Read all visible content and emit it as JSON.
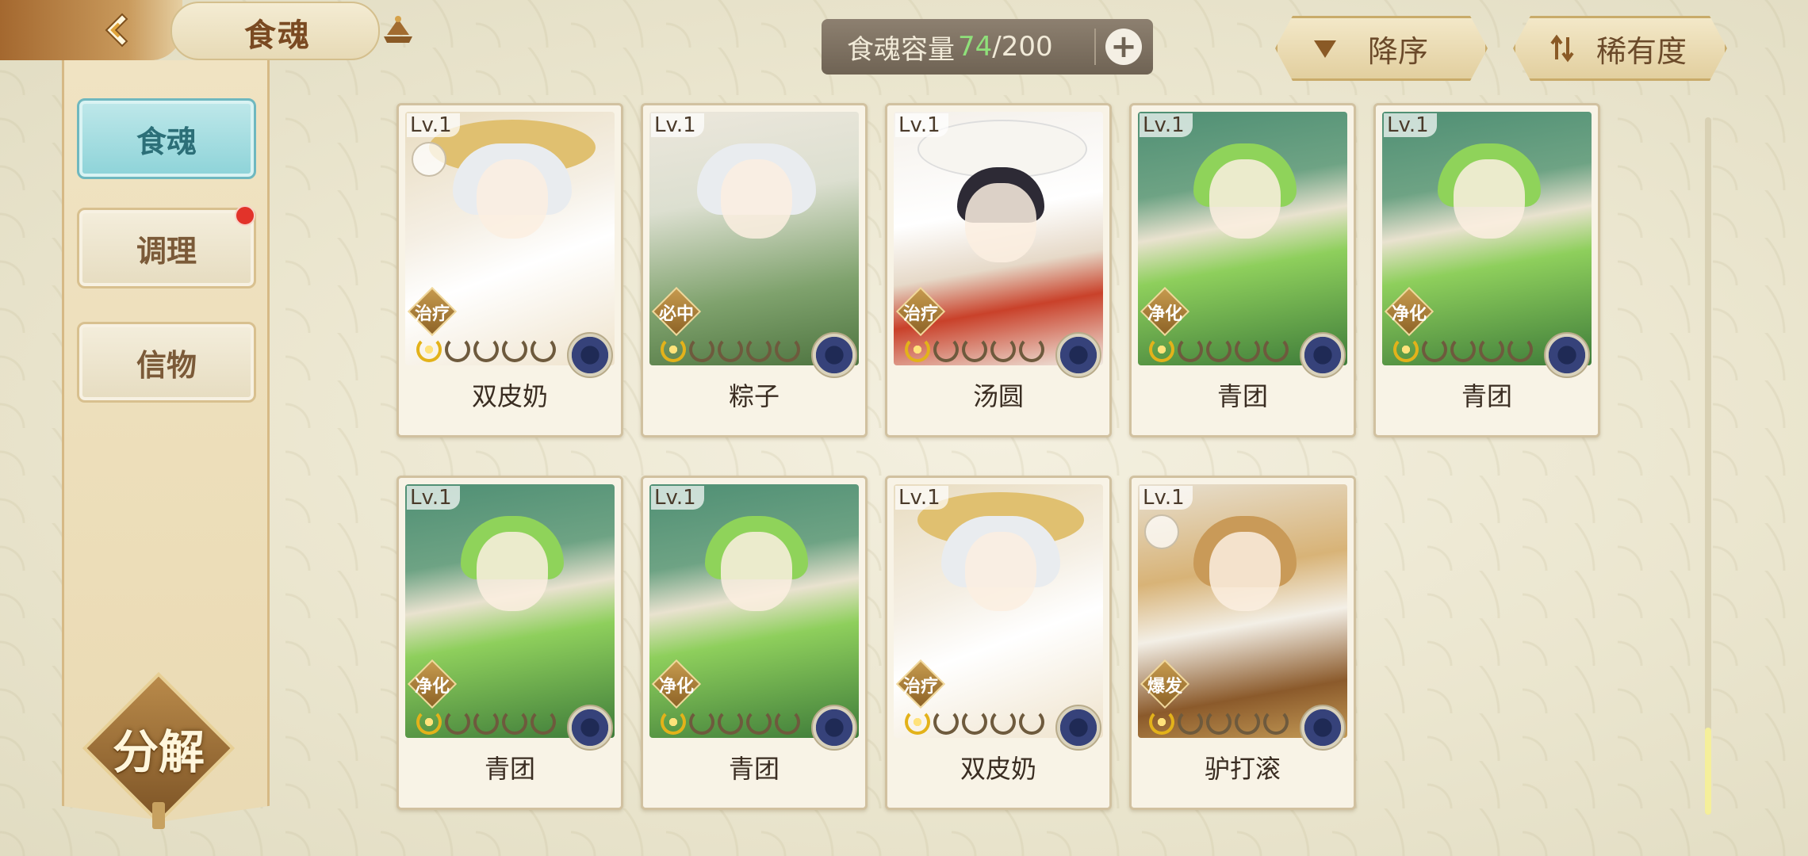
{
  "header": {
    "title": "食魂"
  },
  "sidebar": {
    "tabs": [
      {
        "label": "食魂",
        "active": true
      },
      {
        "label": "调理",
        "badge": true
      },
      {
        "label": "信物"
      }
    ],
    "decompose_label": "分解"
  },
  "capacity": {
    "label": "食魂容量",
    "count": "74",
    "max": "/200",
    "add_icon": "plus-icon"
  },
  "sort": {
    "order_label": "降序",
    "order_icon": "triangle-down-icon",
    "rarity_label": "稀有度",
    "rarity_icon": "sort-arrows-icon"
  },
  "cards": [
    {
      "level": "Lv.1",
      "role": "治疗",
      "name": "双皮奶",
      "stars": 5,
      "lit": 1,
      "art": "straw",
      "pinned": true
    },
    {
      "level": "Lv.1",
      "role": "必中",
      "name": "粽子",
      "stars": 5,
      "lit": 1,
      "art": "zong"
    },
    {
      "level": "Lv.1",
      "role": "治疗",
      "name": "汤圆",
      "stars": 5,
      "lit": 1,
      "art": "tang"
    },
    {
      "level": "Lv.1",
      "role": "净化",
      "name": "青团",
      "stars": 5,
      "lit": 1,
      "art": "qing"
    },
    {
      "level": "Lv.1",
      "role": "净化",
      "name": "青团",
      "stars": 5,
      "lit": 1,
      "art": "qing"
    },
    {
      "level": "Lv.1",
      "role": "净化",
      "name": "青团",
      "stars": 5,
      "lit": 1,
      "art": "qing"
    },
    {
      "level": "Lv.1",
      "role": "净化",
      "name": "青团",
      "stars": 5,
      "lit": 1,
      "art": "qing"
    },
    {
      "level": "Lv.1",
      "role": "治疗",
      "name": "双皮奶",
      "stars": 5,
      "lit": 1,
      "art": "straw"
    },
    {
      "level": "Lv.1",
      "role": "爆发",
      "name": "驴打滚",
      "stars": 5,
      "lit": 1,
      "art": "lv",
      "pinned": true
    }
  ],
  "colors": {
    "accent_active_tab": "#8dd3d8",
    "capacity_count": "#8fe07a",
    "badge": "#e2332a"
  }
}
